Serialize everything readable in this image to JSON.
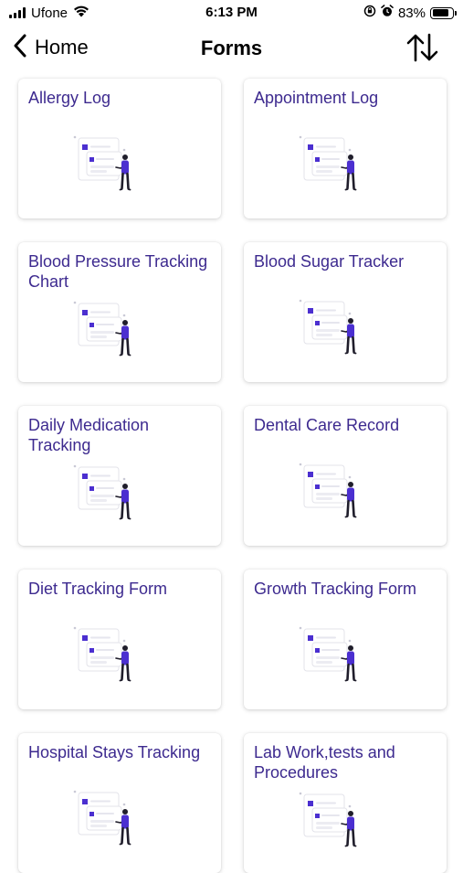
{
  "status_bar": {
    "carrier": "Ufone",
    "time": "6:13 PM",
    "battery_percent": "83%",
    "battery_level": 0.83,
    "icons": [
      "signal-icon",
      "wifi-icon",
      "orientation-lock-icon",
      "alarm-icon",
      "battery-icon"
    ]
  },
  "nav": {
    "back_label": "Home",
    "title": "Forms",
    "sort_icon": "sort-arrows-icon"
  },
  "colors": {
    "title_text": "#3d2a8f",
    "accent": "#4b2fd0"
  },
  "forms": [
    {
      "title": "Allergy Log"
    },
    {
      "title": "Appointment Log"
    },
    {
      "title": "Blood Pressure Tracking Chart"
    },
    {
      "title": "Blood Sugar Tracker"
    },
    {
      "title": "Daily Medication Tracking"
    },
    {
      "title": "Dental Care Record"
    },
    {
      "title": "Diet Tracking Form"
    },
    {
      "title": "Growth Tracking Form"
    },
    {
      "title": "Hospital Stays Tracking"
    },
    {
      "title": "Lab Work,tests and Procedures"
    }
  ]
}
